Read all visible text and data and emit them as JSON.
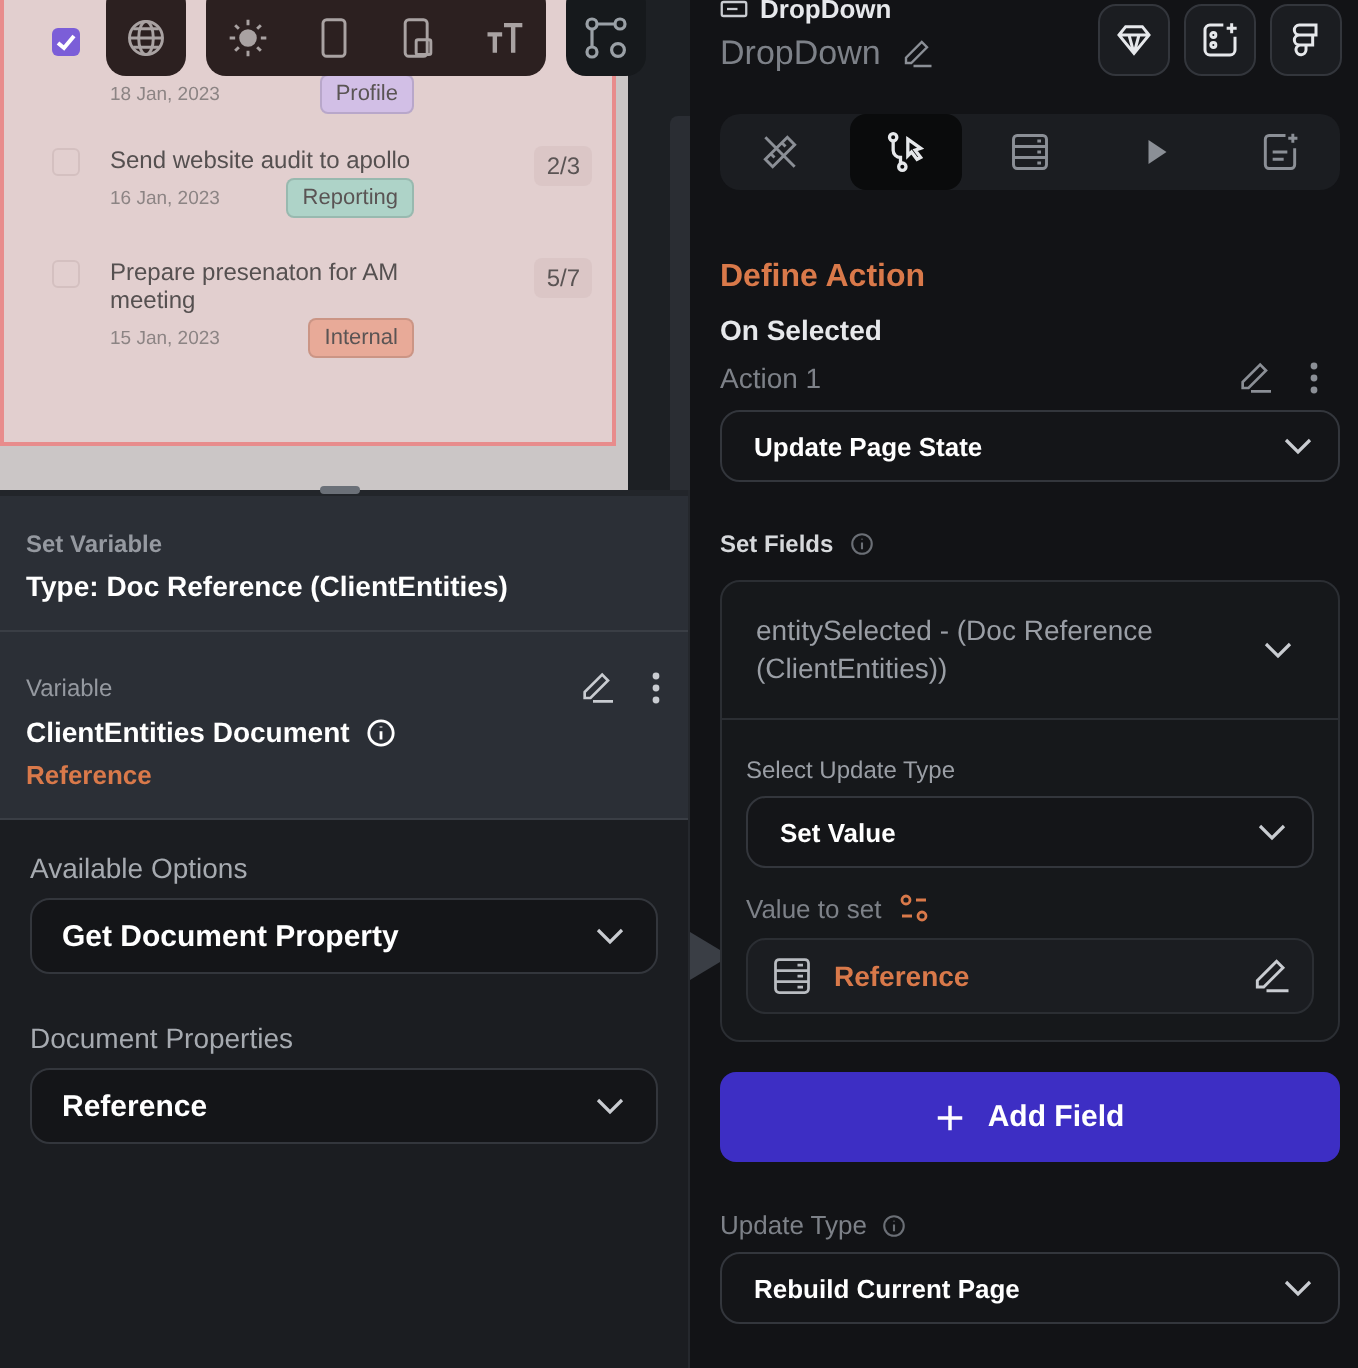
{
  "canvas": {
    "tasks": [
      {
        "checked": true,
        "date": "18 Jan, 2023",
        "tag": "Profile",
        "color": "#d2bfe6"
      },
      {
        "checked": false,
        "title": "Send website audit to apollo",
        "count": "2/3",
        "date": "16 Jan, 2023",
        "tag": "Reporting",
        "color": "#aed3c8"
      },
      {
        "checked": false,
        "title": "Prepare presenaton for AM meeting",
        "count": "5/7",
        "date": "15 Jan, 2023",
        "tag": "Internal",
        "color": "#e8aa98"
      }
    ]
  },
  "variable_popup": {
    "header_label": "Set Variable",
    "type": "Type: Doc Reference (ClientEntities)",
    "variable_label": "Variable",
    "variable_name": "ClientEntities Document",
    "variable_source": "Reference",
    "fields": [
      {
        "label": "Available Options",
        "value": "Get Document Property"
      },
      {
        "label": "Document Properties",
        "value": "Reference"
      }
    ]
  },
  "properties_panel": {
    "widget_type": "DropDown",
    "widget_name": "DropDown",
    "tabs": [
      {
        "selected": false
      },
      {
        "selected": true
      },
      {
        "selected": false
      },
      {
        "selected": false
      },
      {
        "selected": false
      }
    ],
    "section_title": "Define Action",
    "trigger": "On Selected",
    "action_name": "Action 1",
    "action_type": "Update Page State",
    "set_fields_label": "Set Fields",
    "field": {
      "name": "entitySelected - (Doc Reference (ClientEntities))",
      "update_type_label": "Select Update Type",
      "update_type": "Set Value",
      "value_label": "Value to set",
      "value": "Reference"
    },
    "add_button": "Add Field",
    "update_type_label": "Update Type",
    "update_type": "Rebuild Current Page"
  }
}
